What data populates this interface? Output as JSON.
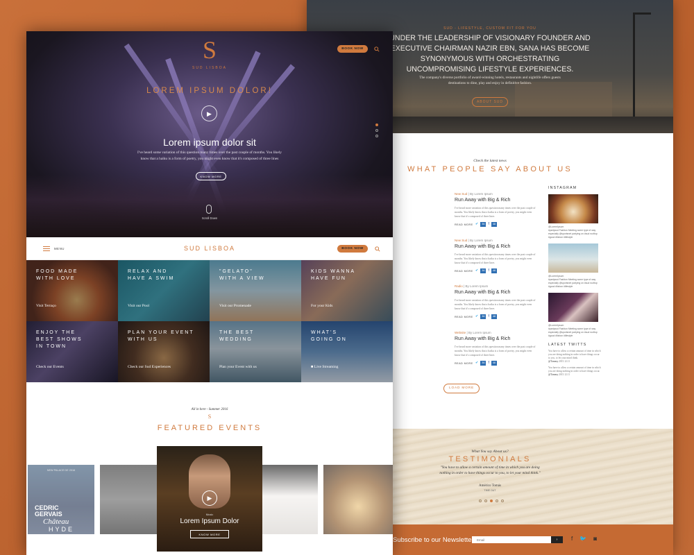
{
  "right_page": {
    "hero": {
      "kicker": "SUD - LIFESTYLE, CUSTOM FIT FOR YOU",
      "headline": "UNDER THE LEADERSHIP OF VISIONARY FOUNDER AND EXECUTIVE CHAIRMAN NAZIR EBN, SANA HAS BECOME SYNONYMOUS WITH ORCHESTRATING UNCOMPROMISING LIFESTYLE EXPERIENCES.",
      "subtext": "The company's diverse portfolio of award-winning hotels, restaurants and nightlife offers guests destinations to dine, play and enjoy in definitive fashion.",
      "button": "ABOUT SUD"
    },
    "news": {
      "kicker": "Check the latest news",
      "title": "WHAT PEOPLE SAY ABOUT US",
      "items": [
        {
          "category": "New Sud",
          "author": "By Lorem Ipsum",
          "title": "Run Away with Big & Rich",
          "excerpt": "I've heard more variation of this question many times over the past couple of months. You likely know that a haiku is a form of poetry, you might even know that it's composed of three lines",
          "read_more": "READ MORE",
          "tw_count": "36",
          "fb_count": "48"
        },
        {
          "category": "New Sud",
          "author": "By Lorem Ipsum",
          "title": "Run Away with Big & Rich",
          "excerpt": "I've heard more variation of this question many times over the past couple of months. You likely know that a haiku is a form of poetry, you might even know that it's composed of three lines",
          "read_more": "READ MORE",
          "tw_count": "36",
          "fb_count": "48"
        },
        {
          "category": "Radio",
          "author": "By Lorem Ipsum",
          "title": "Run Away with Big & Rich",
          "excerpt": "I've heard more variation of this question many times over the past couple of months. You likely know that a haiku is a form of poetry, you might even know that it's composed of three lines",
          "read_more": "READ MORE",
          "tw_count": "36",
          "fb_count": "48"
        },
        {
          "category": "Website",
          "author": "By Lorem Ipsum",
          "title": "Run Away with Big & Rich",
          "excerpt": "I've heard more variation of this question many times over the past couple of months. You likely know that a haiku is a form of poetry, you might even know that it's composed of three lines",
          "read_more": "READ MORE",
          "tw_count": "36",
          "fb_count": "48"
        }
      ],
      "load_more": "LOAD MORE"
    },
    "sidebar": {
      "instagram_title": "INSTAGRAM",
      "insta": [
        {
          "handle": "@LoremIpsum",
          "caption": "#partysud Fashion Meeting some type of way especially @sportsnet partying on #sud rooftop #good #lisbon #lifestyle"
        },
        {
          "handle": "@LoremIpsum",
          "caption": "#partysud Fashion Meeting some type of way especially @sportsnet partying on #sud rooftop #good #lisbon #lifestyle"
        },
        {
          "handle": "@LoremIpsum",
          "caption": "#partysud Fashion Meeting some type of way especially @sportsnet partying on #sud rooftop #good #lisbon #lifestyle"
        }
      ],
      "tweets_title": "LATEST TWITTS",
      "tweets": [
        {
          "text": "You have to allow a certain amount of time in which you are doing nothing in order to have things occur to you, to let your mind think.",
          "handle": "@Tammy",
          "date": "2015.12.11"
        },
        {
          "text": "You have to allow a certain amount of time in which you are doing nothing in order to have things occur.",
          "handle": "@Tammy",
          "date": "2015.12.11"
        }
      ]
    },
    "testimonials": {
      "kicker": "What You say About us?",
      "title": "TESTIMONIALS",
      "quote": "\"You have to allow a certain amount of time in which you are doing nothing in order to have things occur to you, to let your mind think.\"",
      "name": "Américo Tomás",
      "role": "TIME OUT"
    },
    "newsletter": {
      "label": "Subscribe to our Newsletter",
      "placeholder": "Email",
      "submit": "›"
    }
  },
  "left_page": {
    "hero": {
      "logo_letter": "S",
      "logo_text": "SUD LISBOA",
      "book_now": "BOOK NOW",
      "kicker": "LOREM IPSUM DOLOR!",
      "title": "Lorem ipsum dolor sit",
      "subtext": "I've heard some variation of this question many times over the past couple of months. You likely know that a haiku is a form of poetry, you might even know that it's composed of three lines",
      "button": "KNOW MORE",
      "scroll": "Scroll Down"
    },
    "nav": {
      "menu": "MENU",
      "logo": "SUD LISBOA",
      "book_now": "BOOK NOW"
    },
    "tiles": [
      {
        "title1": "FOOD MADE",
        "title2": "WITH LOVE",
        "link": "Visit Terraço"
      },
      {
        "title1": "RELAX AND",
        "title2": "HAVE A SWIM",
        "link": "Visit our Pool"
      },
      {
        "title1": "\"GELATO\"",
        "title2": "WITH A VIEW",
        "link": "Visit our Promenade"
      },
      {
        "title1": "KIDS WANNA",
        "title2": "HAVE FUN",
        "link": "For your Kids"
      },
      {
        "title1": "ENJOY THE",
        "title2": "BEST SHOWS",
        "title3": "IN TOWN",
        "link": "Check our Events"
      },
      {
        "title1": "PLAN YOUR EVENT",
        "title2": "WITH US",
        "link": "Check our Sud Experiences"
      },
      {
        "title1": "THE BEST",
        "title2": "WEDDING",
        "link": "Plan your Event with us"
      },
      {
        "title1": "WHAT'S",
        "title2": "GOING ON",
        "link": "Live Streaming"
      }
    ],
    "events": {
      "kicker": "All in here - Summer 2016",
      "letter": "S",
      "title": "FEATURED EVENTS",
      "cedric_top": "NEW PALACE DE 2016",
      "cedric_name1": "CEDRIC",
      "cedric_name2": "GERVAIS",
      "cedric_venue1": "Château",
      "cedric_venue2": "HYDE",
      "featured_category": "Music",
      "featured_title": "Lorem Ipsum Dolor",
      "featured_button": "KNOW MORE"
    }
  },
  "colors": {
    "accent": "#d07a3e",
    "background": "#c56a33"
  }
}
